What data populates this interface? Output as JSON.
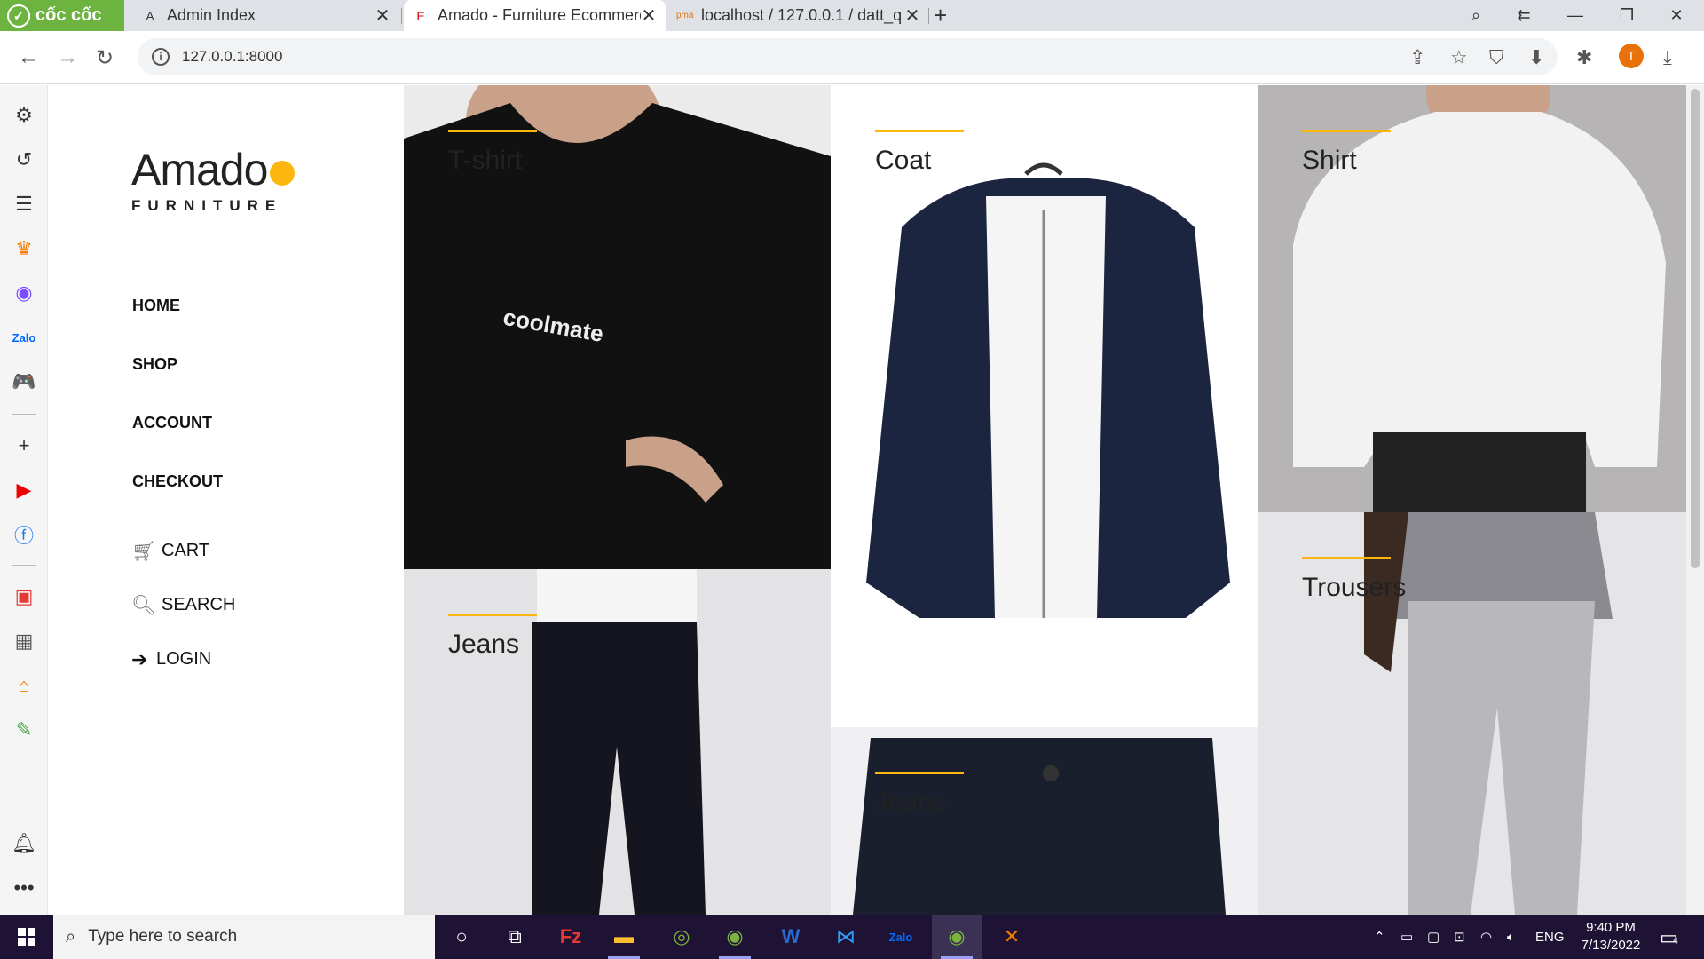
{
  "browser": {
    "brand": "cốc cốc",
    "tabs": [
      {
        "title": "Admin Index",
        "favicon": "A",
        "active": false
      },
      {
        "title": "Amado - Furniture Ecommerce",
        "favicon": "E",
        "active": true
      },
      {
        "title": "localhost / 127.0.0.1 / datt_q",
        "favicon": "pma",
        "active": false
      }
    ],
    "url": "127.0.0.1:8000",
    "profile_initial": "T"
  },
  "sidebar_icons": [
    "gear-icon",
    "history-icon",
    "list-icon",
    "crown-icon",
    "messenger-icon",
    "zalo-icon",
    "gamepad-icon",
    "plus-icon",
    "youtube-icon",
    "facebook-icon",
    "calendar-icon",
    "photo-icon",
    "shop-icon",
    "map-icon",
    "bell-icon",
    "more-icon"
  ],
  "site": {
    "logo": {
      "word": "Amado",
      "sub": "FURNITURE"
    },
    "menu": [
      "HOME",
      "SHOP",
      "ACCOUNT",
      "CHECKOUT"
    ],
    "extra": {
      "cart": "CART",
      "search": "SEARCH",
      "login": "LOGIN"
    }
  },
  "products": [
    {
      "label": "T-shirt",
      "color": "#111111"
    },
    {
      "label": "Coat",
      "color": "#1c2540"
    },
    {
      "label": "Shirt",
      "color": "#f2f2f2"
    },
    {
      "label": "Jeans",
      "color": "#14151f"
    },
    {
      "label": "Trousers",
      "color": "#b8b8bc"
    },
    {
      "label": "Jeans",
      "color": "#1a1f2e"
    }
  ],
  "taskbar": {
    "search_placeholder": "Type here to search",
    "language": "ENG",
    "time": "9:40 PM",
    "date": "7/13/2022",
    "notification_count": "4"
  },
  "colors": {
    "accent": "#fbb710",
    "brand_green": "#6cb33f",
    "taskbar": "#1f1335"
  }
}
